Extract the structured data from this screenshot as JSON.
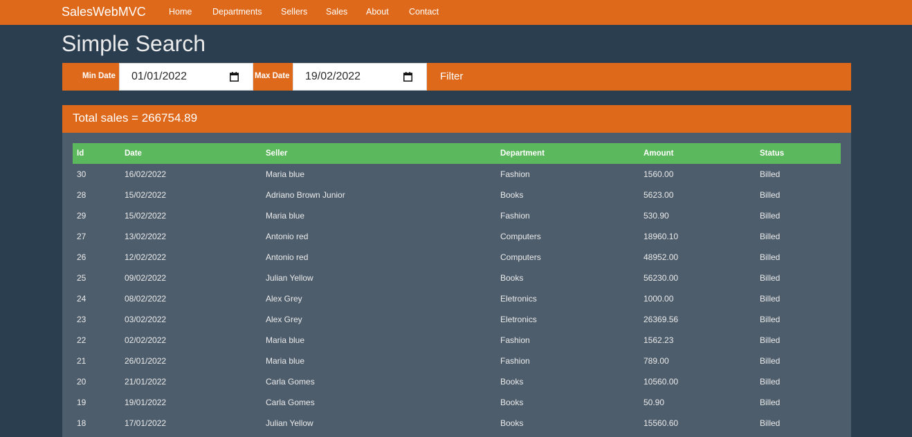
{
  "nav": {
    "brand": "SalesWebMVC",
    "links": [
      "Home",
      "Departments",
      "Sellers",
      "Sales",
      "About",
      "Contact"
    ]
  },
  "page": {
    "title": "Simple Search"
  },
  "filter": {
    "min_label": "Min Date",
    "min_value": "01/01/2022",
    "max_label": "Max Date",
    "max_value": "19/02/2022",
    "button_label": "Filter"
  },
  "summary": {
    "total_text": "Total sales = 266754.89"
  },
  "table": {
    "headers": [
      "Id",
      "Date",
      "Seller",
      "Department",
      "Amount",
      "Status"
    ],
    "rows": [
      [
        "30",
        "16/02/2022",
        "Maria blue",
        "Fashion",
        "1560.00",
        "Billed"
      ],
      [
        "28",
        "15/02/2022",
        "Adriano Brown Junior",
        "Books",
        "5623.00",
        "Billed"
      ],
      [
        "29",
        "15/02/2022",
        "Maria blue",
        "Fashion",
        "530.90",
        "Billed"
      ],
      [
        "27",
        "13/02/2022",
        "Antonio red",
        "Computers",
        "18960.10",
        "Billed"
      ],
      [
        "26",
        "12/02/2022",
        "Antonio red",
        "Computers",
        "48952.00",
        "Billed"
      ],
      [
        "25",
        "09/02/2022",
        "Julian Yellow",
        "Books",
        "56230.00",
        "Billed"
      ],
      [
        "24",
        "08/02/2022",
        "Alex Grey",
        "Eletronics",
        "1000.00",
        "Billed"
      ],
      [
        "23",
        "03/02/2022",
        "Alex Grey",
        "Eletronics",
        "26369.56",
        "Billed"
      ],
      [
        "22",
        "02/02/2022",
        "Maria blue",
        "Fashion",
        "1562.23",
        "Billed"
      ],
      [
        "21",
        "26/01/2022",
        "Maria blue",
        "Fashion",
        "789.00",
        "Billed"
      ],
      [
        "20",
        "21/01/2022",
        "Carla Gomes",
        "Books",
        "10560.00",
        "Billed"
      ],
      [
        "19",
        "19/01/2022",
        "Carla Gomes",
        "Books",
        "50.90",
        "Billed"
      ],
      [
        "18",
        "17/01/2022",
        "Julian Yellow",
        "Books",
        "15560.60",
        "Billed"
      ]
    ]
  },
  "colors": {
    "background": "#2b3e50",
    "accent": "#df691a",
    "panel": "#4e5d6c",
    "table_header": "#5cb85c"
  },
  "icons": {
    "date_picker": "calendar-icon"
  }
}
